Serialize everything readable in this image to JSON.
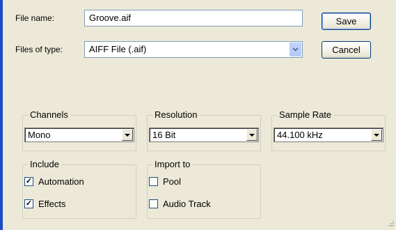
{
  "file_name": {
    "label": "File name:",
    "value": "Groove.aif"
  },
  "file_type": {
    "label": "Files of type:",
    "value": "AIFF File (.aif)"
  },
  "buttons": {
    "save": "Save",
    "cancel": "Cancel"
  },
  "channels": {
    "title": "Channels",
    "value": "Mono"
  },
  "resolution": {
    "title": "Resolution",
    "value": "16 Bit"
  },
  "sample_rate": {
    "title": "Sample Rate",
    "value": "44.100 kHz"
  },
  "include": {
    "title": "Include",
    "automation": {
      "label": "Automation",
      "checked": true
    },
    "effects": {
      "label": "Effects",
      "checked": true
    }
  },
  "import_to": {
    "title": "Import to",
    "pool": {
      "label": "Pool",
      "checked": false
    },
    "audio_track": {
      "label": "Audio Track",
      "checked": false
    }
  },
  "colors": {
    "window_bg": "#ece9d8",
    "accent_border": "#1e4cc8",
    "field_border": "#7f9db9"
  },
  "icons": {
    "combo_arrow": "chevron-down-icon",
    "select_arrow": "triangle-down-icon",
    "check": "checkmark-icon",
    "grip": "resize-grip-icon"
  }
}
